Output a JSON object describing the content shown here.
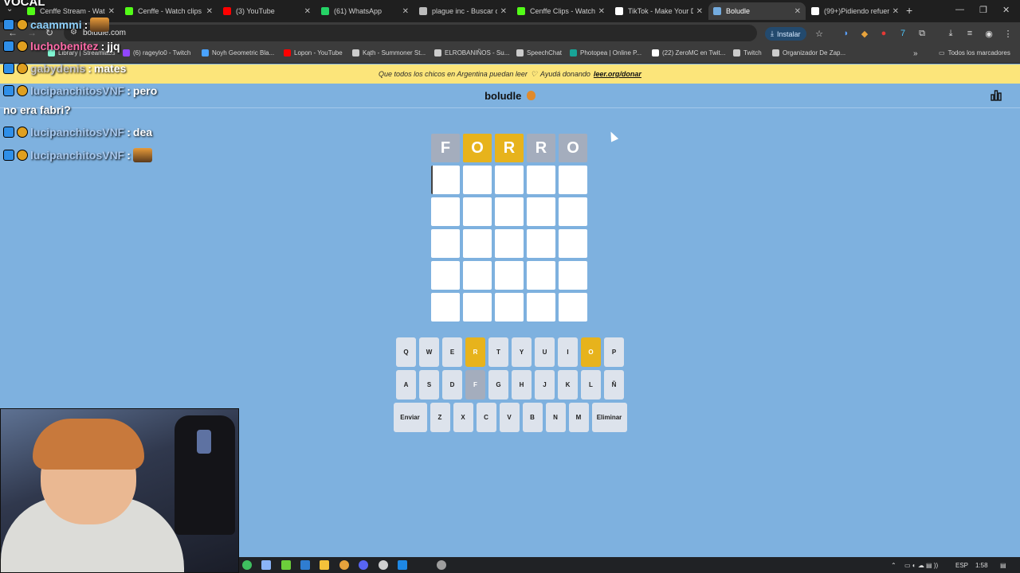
{
  "browser": {
    "tabs": [
      {
        "title": "Cenffe Stream - Watc",
        "color": "#53fc18"
      },
      {
        "title": "Cenffe - Watch clips",
        "color": "#53fc18"
      },
      {
        "title": "(3) YouTube",
        "color": "#ff0000"
      },
      {
        "title": "(61) WhatsApp",
        "color": "#25d366"
      },
      {
        "title": "plague inc - Buscar c",
        "color": "#bbbbbb"
      },
      {
        "title": "Cenffe Clips - Watch",
        "color": "#53fc18"
      },
      {
        "title": "TikTok - Make Your D",
        "color": "#ffffff"
      },
      {
        "title": "Boludle",
        "color": "#74acdf",
        "active": true
      },
      {
        "title": "(99+)Pidiendo refuer",
        "color": "#ffffff"
      }
    ],
    "url": "boludle.com",
    "install_label": "Instalar",
    "bookmarks": [
      {
        "label": "Library | Streamlabs",
        "color": "#80f5d2"
      },
      {
        "label": "(6) rageylo0 - Twitch",
        "color": "#9146ff"
      },
      {
        "label": "Noyh Geometric Bla...",
        "color": "#4aa3ff"
      },
      {
        "label": "Lopon - YouTube",
        "color": "#ff0000"
      },
      {
        "label": "Kąth - Summoner St...",
        "color": "#cccccc"
      },
      {
        "label": "ELROBANIÑOS - Su...",
        "color": "#cccccc"
      },
      {
        "label": "SpeechChat",
        "color": "#cccccc"
      },
      {
        "label": "Photopea | Online P...",
        "color": "#18a497"
      },
      {
        "label": "(22) ZeroMC en Twit...",
        "color": "#ffffff"
      },
      {
        "label": "Twitch",
        "color": "#cccccc"
      },
      {
        "label": "Organizador De Zap...",
        "color": "#cccccc"
      }
    ],
    "all_bookmarks_label": "Todos los marcadores"
  },
  "page": {
    "banner_text": "Que todos los chicos en Argentina puedan leer",
    "banner_heart": "♡",
    "banner_cta": "Ayudá donando",
    "banner_link": "leer.org/donar",
    "logo": "boludle"
  },
  "game": {
    "board": [
      [
        {
          "l": "F",
          "s": "absent"
        },
        {
          "l": "O",
          "s": "present"
        },
        {
          "l": "R",
          "s": "present"
        },
        {
          "l": "R",
          "s": "absent"
        },
        {
          "l": "O",
          "s": "absent"
        }
      ],
      [
        {
          "l": "",
          "s": "empty"
        },
        {
          "l": "",
          "s": "empty"
        },
        {
          "l": "",
          "s": "empty"
        },
        {
          "l": "",
          "s": "empty"
        },
        {
          "l": "",
          "s": "empty"
        }
      ],
      [
        {
          "l": "",
          "s": "empty"
        },
        {
          "l": "",
          "s": "empty"
        },
        {
          "l": "",
          "s": "empty"
        },
        {
          "l": "",
          "s": "empty"
        },
        {
          "l": "",
          "s": "empty"
        }
      ],
      [
        {
          "l": "",
          "s": "empty"
        },
        {
          "l": "",
          "s": "empty"
        },
        {
          "l": "",
          "s": "empty"
        },
        {
          "l": "",
          "s": "empty"
        },
        {
          "l": "",
          "s": "empty"
        }
      ],
      [
        {
          "l": "",
          "s": "empty"
        },
        {
          "l": "",
          "s": "empty"
        },
        {
          "l": "",
          "s": "empty"
        },
        {
          "l": "",
          "s": "empty"
        },
        {
          "l": "",
          "s": "empty"
        }
      ],
      [
        {
          "l": "",
          "s": "empty"
        },
        {
          "l": "",
          "s": "empty"
        },
        {
          "l": "",
          "s": "empty"
        },
        {
          "l": "",
          "s": "empty"
        },
        {
          "l": "",
          "s": "empty"
        }
      ]
    ],
    "keyboard": [
      [
        {
          "k": "Q"
        },
        {
          "k": "W"
        },
        {
          "k": "E"
        },
        {
          "k": "R",
          "s": "present"
        },
        {
          "k": "T"
        },
        {
          "k": "Y"
        },
        {
          "k": "U"
        },
        {
          "k": "I"
        },
        {
          "k": "O",
          "s": "present"
        },
        {
          "k": "P"
        }
      ],
      [
        {
          "k": "A"
        },
        {
          "k": "S"
        },
        {
          "k": "D"
        },
        {
          "k": "F",
          "s": "absent"
        },
        {
          "k": "G"
        },
        {
          "k": "H"
        },
        {
          "k": "J"
        },
        {
          "k": "K"
        },
        {
          "k": "L"
        },
        {
          "k": "Ñ"
        }
      ],
      [
        {
          "k": "Enviar",
          "w": "wide"
        },
        {
          "k": "Z"
        },
        {
          "k": "X"
        },
        {
          "k": "C"
        },
        {
          "k": "V"
        },
        {
          "k": "B"
        },
        {
          "k": "N"
        },
        {
          "k": "M"
        },
        {
          "k": "Eliminar",
          "w": "wider"
        }
      ]
    ]
  },
  "overlay": {
    "title": "VOCAL",
    "chat": [
      {
        "user": "caammmi",
        "msg": "",
        "color": "white"
      },
      {
        "user": "luchobenitez",
        "msg": "jjq",
        "color": "pink"
      },
      {
        "user": "gabydenis",
        "msg": "mates",
        "color": "gray"
      },
      {
        "user": "lucipanchitosVNF",
        "msg": "pero",
        "color": "blue"
      },
      {
        "user": "",
        "msg": "no era fabri?",
        "color": "white"
      },
      {
        "user": "lucipanchitosVNF",
        "msg": "dea",
        "color": "blue"
      },
      {
        "user": "lucipanchitosVNF",
        "msg": "",
        "color": "blue"
      }
    ]
  },
  "taskbar": {
    "lang": "ESP",
    "time": "1:58"
  }
}
